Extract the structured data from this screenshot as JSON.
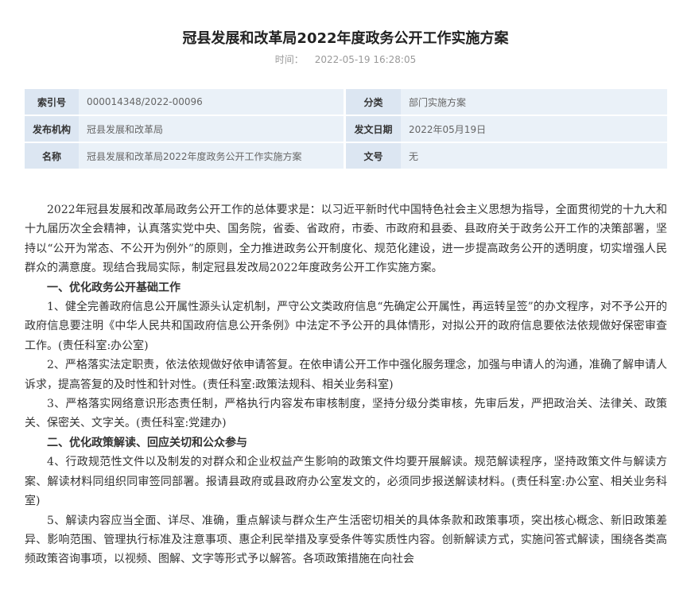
{
  "header": {
    "title": "冠县发展和改革局2022年度政务公开工作实施方案",
    "time_label": "时间：",
    "time_value": "2022-05-19 16:28:05"
  },
  "info_table": {
    "rows": [
      {
        "label_1": "索引号",
        "value_1": "000014348/2022-00096",
        "label_2": "分类",
        "value_2": "部门实施方案"
      },
      {
        "label_1": "发布机构",
        "value_1": "冠县发展和改革局",
        "label_2": "发文日期",
        "value_2": "2022年05月19日"
      },
      {
        "label_1": "名称",
        "value_1": "冠县发展和改革局2022年度政务公开工作实施方案",
        "label_2": "文号",
        "value_2": "无"
      }
    ]
  },
  "body": {
    "intro": "2022年冠县发展和改革局政务公开工作的总体要求是：以习近平新时代中国特色社会主义思想为指导，全面贯彻党的十九大和十九届历次全会精神，认真落实党中央、国务院，省委、省政府，市委、市政府和县委、县政府关于政务公开工作的决策部署，坚持以“公开为常态、不公开为例外”的原则，全力推进政务公开制度化、规范化建设，进一步提高政务公开的透明度，切实增强人民群众的满意度。现结合我局实际，制定冠县发改局2022年度政务公开工作实施方案。",
    "section1_heading": "一、优化政务公开基础工作",
    "item1": "1、健全完善政府信息公开属性源头认定机制，严守公文类政府信息“先确定公开属性，再运转呈签”的办文程序，对不予公开的政府信息要注明《中华人民共和国政府信息公开条例》中法定不予公开的具体情形，对拟公开的政府信息要依法依规做好保密审查工作。(责任科室:办公室)",
    "item2": "2、严格落实法定职责，依法依规做好依申请答复。在依申请公开工作中强化服务理念，加强与申请人的沟通，准确了解申请人诉求，提高答复的及时性和针对性。(责任科室:政策法规科、相关业务科室)",
    "item3": "3、严格落实网络意识形态责任制，严格执行内容发布审核制度，坚持分级分类审核，先审后发，严把政治关、法律关、政策关、保密关、文字关。(责任科室:党建办)",
    "section2_heading": "二、优化政策解读、回应关切和公众参与",
    "item4": "4、行政规范性文件以及制发的对群众和企业权益产生影响的政策文件均要开展解读。规范解读程序，坚持政策文件与解读方案、解读材料同组织同审签同部署。报请县政府或县政府办公室发文的，必须同步报送解读材料。(责任科室:办公室、相关业务科室)",
    "item5": "5、解读内容应当全面、详尽、准确，重点解读与群众生产生活密切相关的具体条款和政策事项，突出核心概念、新旧政策差异、影响范围、管理执行标准及注意事项、惠企利民举措及享受条件等实质性内容。创新解读方式，实施问答式解读，围绕各类高频政策咨询事项，以视频、图解、文字等形式予以解答。各项政策措施在向社会"
  }
}
